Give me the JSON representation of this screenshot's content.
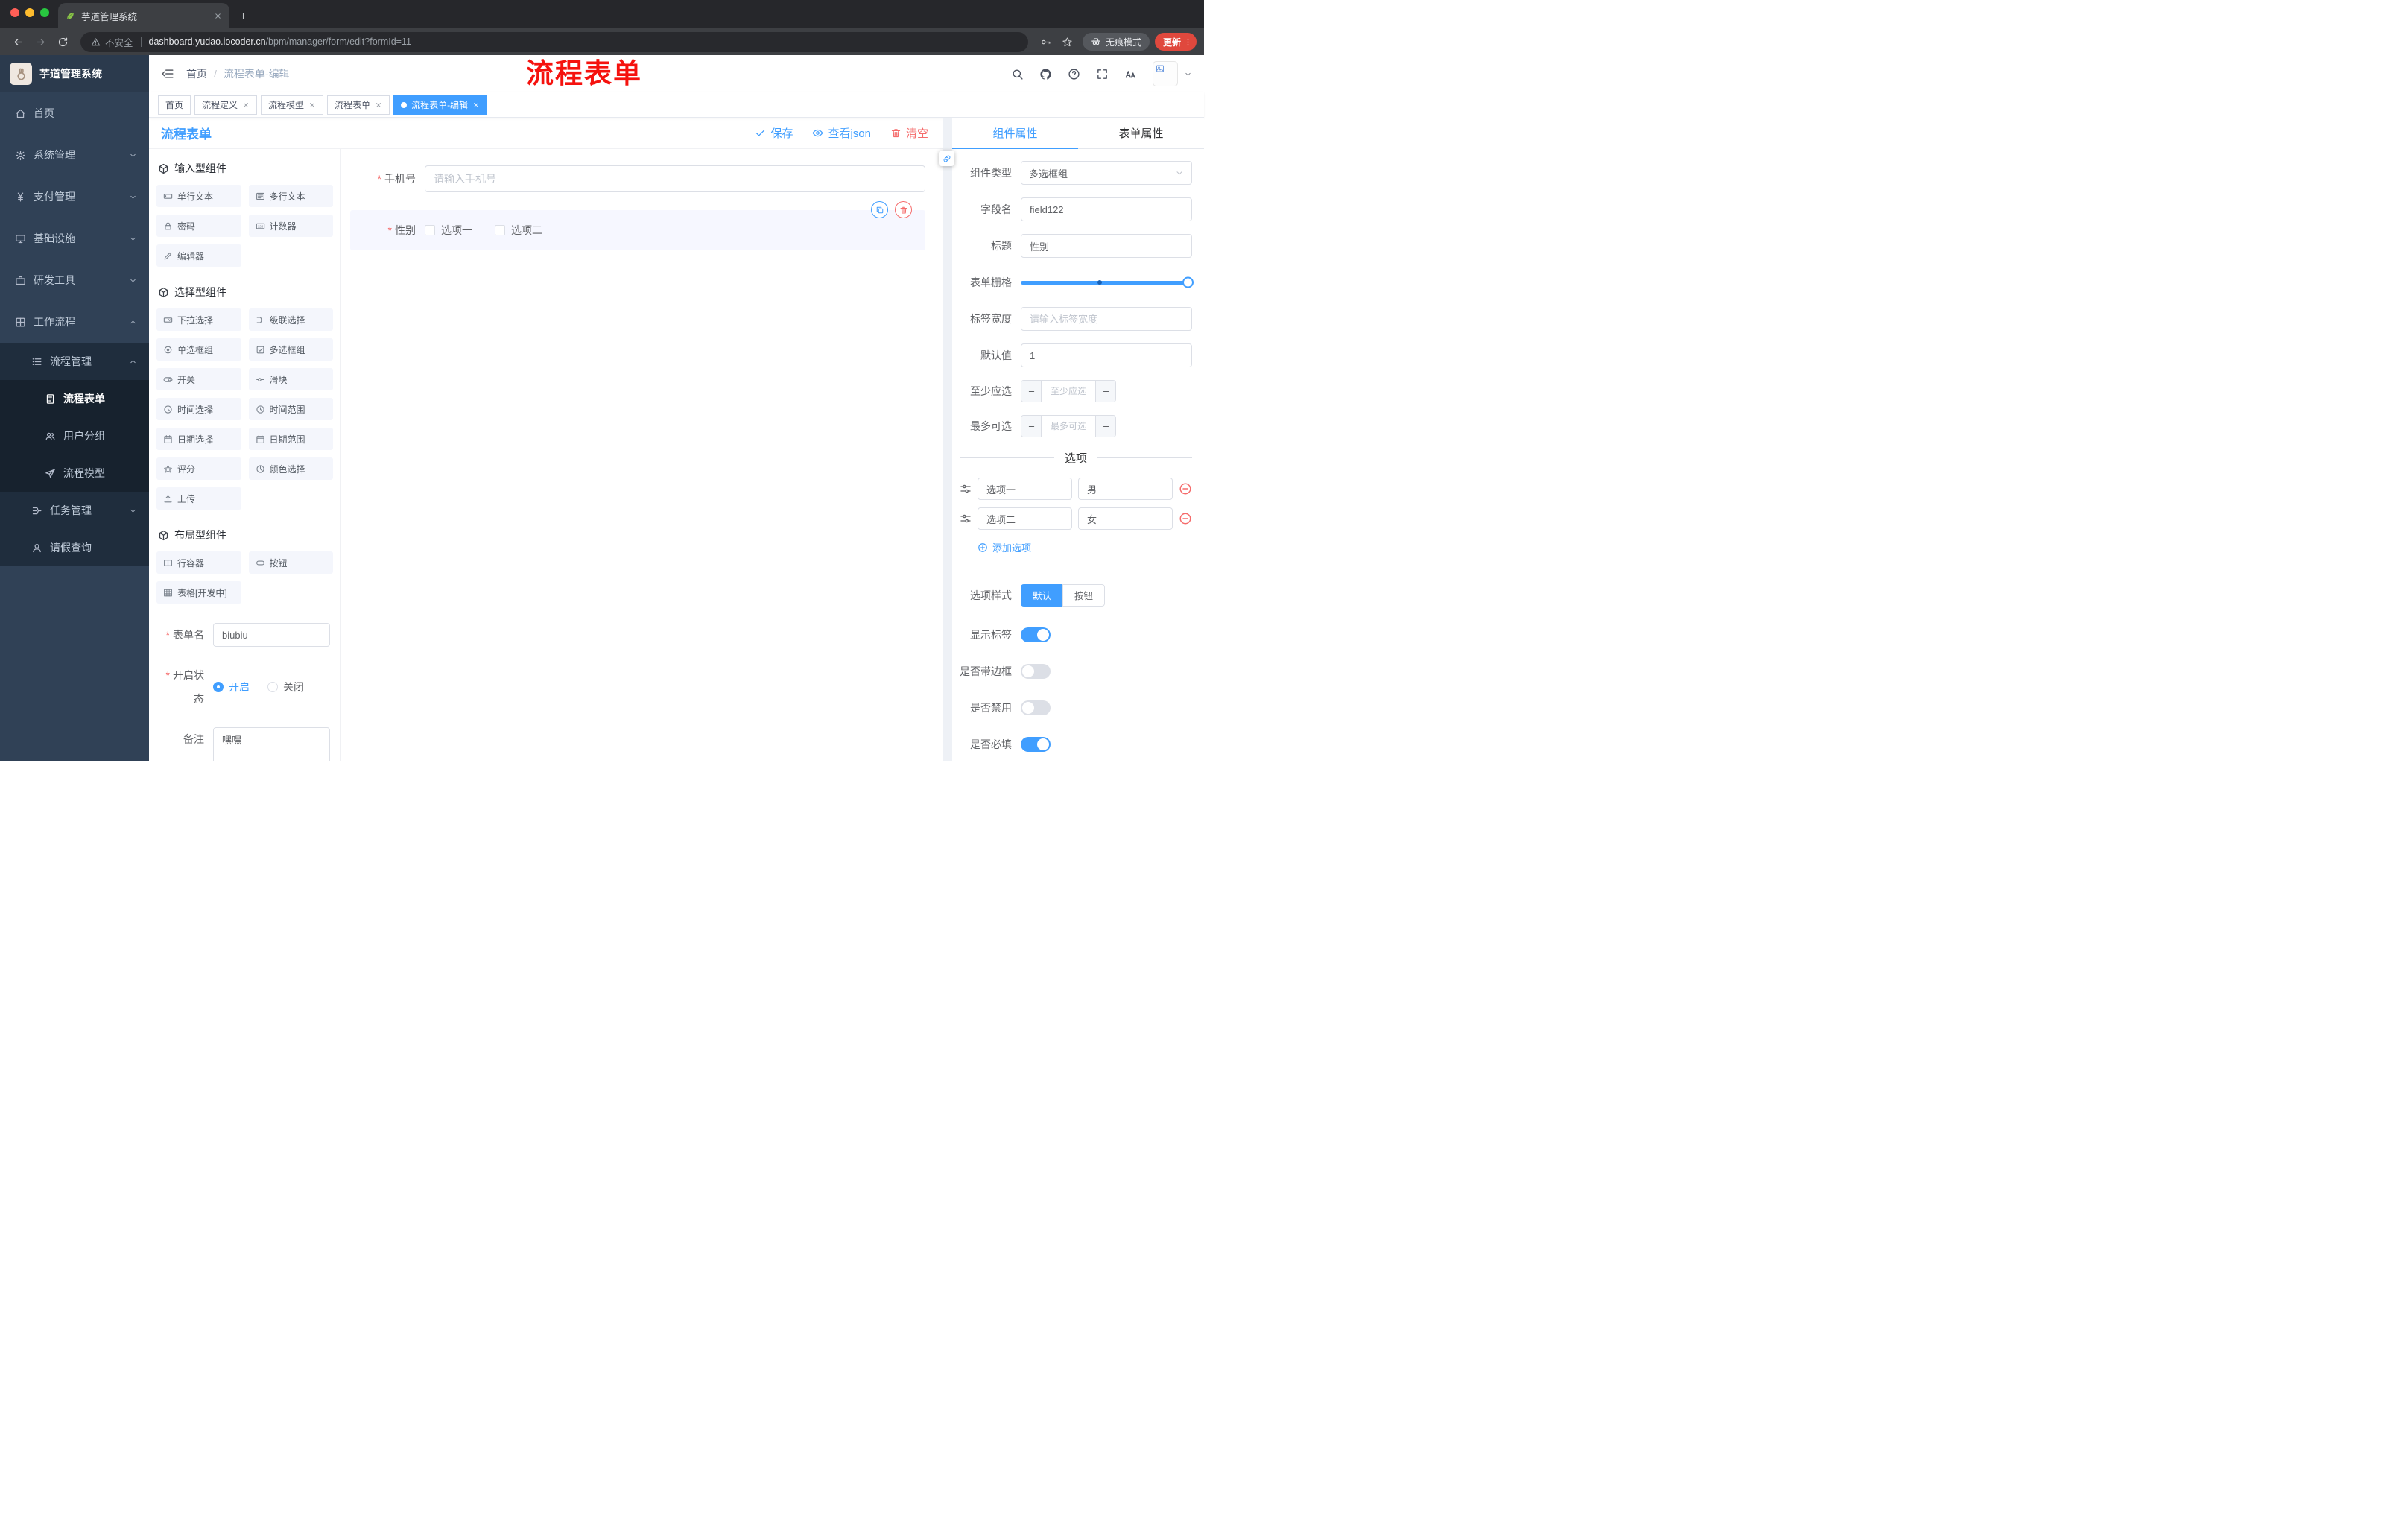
{
  "colors": {
    "primary": "#409eff",
    "danger": "#f56c6c",
    "sidebar_bg": "#304156",
    "annotation_red": "#f5120e",
    "update_button": "#e0483d"
  },
  "browser": {
    "tab_title": "芋道管理系统",
    "security_label": "不安全",
    "url_host": "dashboard.yudao.iocoder.cn",
    "url_path": "/bpm/manager/form/edit?formId=11",
    "incognito_label": "无痕模式",
    "update_label": "更新"
  },
  "sidebar": {
    "logo_text": "芋道管理系统",
    "items": [
      {
        "label": "首页"
      },
      {
        "label": "系统管理"
      },
      {
        "label": "支付管理"
      },
      {
        "label": "基础设施"
      },
      {
        "label": "研发工具"
      },
      {
        "label": "工作流程"
      },
      {
        "label": "流程管理"
      },
      {
        "label": "流程表单"
      },
      {
        "label": "用户分组"
      },
      {
        "label": "流程模型"
      },
      {
        "label": "任务管理"
      },
      {
        "label": "请假查询"
      }
    ]
  },
  "navbar": {
    "breadcrumb_root": "首页",
    "breadcrumb_sep": "/",
    "breadcrumb_current": "流程表单-编辑",
    "annotation": "流程表单"
  },
  "tags": [
    {
      "label": "首页"
    },
    {
      "label": "流程定义"
    },
    {
      "label": "流程模型"
    },
    {
      "label": "流程表单"
    },
    {
      "label": "流程表单-编辑"
    }
  ],
  "editor": {
    "title": "流程表单",
    "save": "保存",
    "view_json": "查看json",
    "clear": "清空"
  },
  "palette": {
    "group_input": {
      "title": "输入型组件",
      "items": [
        "单行文本",
        "多行文本",
        "密码",
        "计数器",
        "编辑器"
      ]
    },
    "group_select": {
      "title": "选择型组件",
      "items": [
        "下拉选择",
        "级联选择",
        "单选框组",
        "多选框组",
        "开关",
        "滑块",
        "时间选择",
        "时间范围",
        "日期选择",
        "日期范围",
        "评分",
        "颜色选择",
        "上传"
      ]
    },
    "group_layout": {
      "title": "布局型组件",
      "items": [
        "行容器",
        "按钮",
        "表格[开发中]"
      ]
    }
  },
  "meta": {
    "form_name_label": "表单名",
    "form_name_value": "biubiu",
    "status_label": "开启状态",
    "status_on": "开启",
    "status_off": "关闭",
    "remark_label": "备注",
    "remark_value": "嘿嘿"
  },
  "canvas": {
    "phone_label": "手机号",
    "phone_placeholder": "请输入手机号",
    "gender_label": "性别",
    "gender_opt1": "选项一",
    "gender_opt2": "选项二"
  },
  "props": {
    "tab_component": "组件属性",
    "tab_form": "表单属性",
    "type_label": "组件类型",
    "type_value": "多选框组",
    "field_label": "字段名",
    "field_value": "field122",
    "title_label": "标题",
    "title_value": "性别",
    "grid_label": "表单栅格",
    "labelw_label": "标签宽度",
    "labelw_placeholder": "请输入标签宽度",
    "default_label": "默认值",
    "default_value": "1",
    "min_label": "至少应选",
    "min_placeholder": "至少应选",
    "max_label": "最多可选",
    "max_placeholder": "最多可选",
    "options_title": "选项",
    "opt1_label": "选项一",
    "opt1_value": "男",
    "opt2_label": "选项二",
    "opt2_value": "女",
    "add_option": "添加选项",
    "style_label": "选项样式",
    "style_default": "默认",
    "style_button": "按钮",
    "switch_show_label": "显示标签",
    "switch_border": "是否带边框",
    "switch_disabled": "是否禁用",
    "switch_required": "是否必填"
  }
}
